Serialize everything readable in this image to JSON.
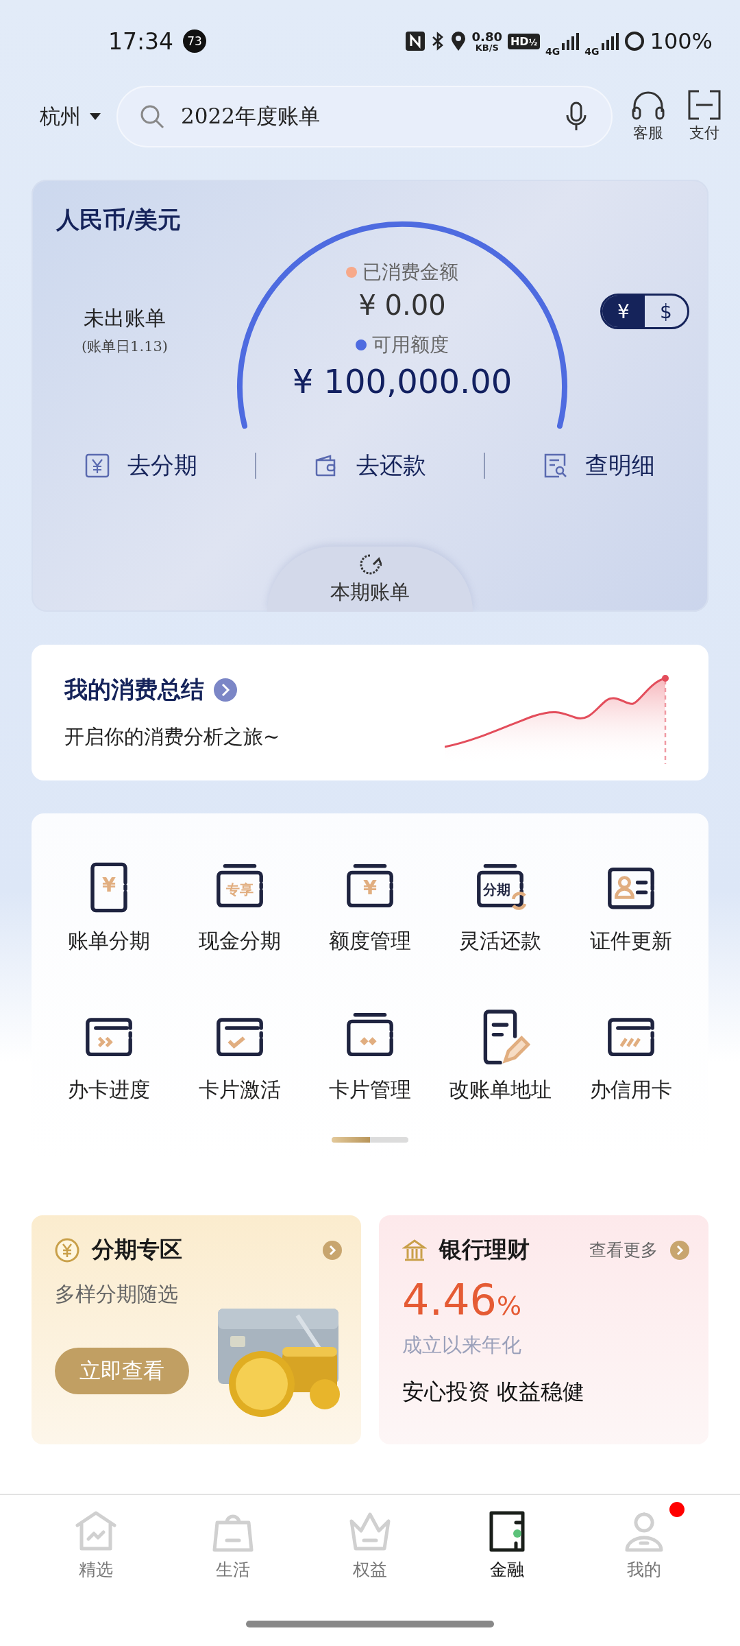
{
  "status_bar": {
    "time": "17:34",
    "notification_count": "73",
    "speed_value": "0.80",
    "speed_unit": "KB/S",
    "hd": "HD",
    "hd_index": "½",
    "networks": [
      "4G",
      "4G"
    ],
    "battery": "100%"
  },
  "header": {
    "city": "杭州",
    "search": {
      "value": "2022年度账单"
    },
    "actions": [
      "客服",
      "支付"
    ]
  },
  "bill_card": {
    "title": "人民币/美元",
    "status": "未出账单",
    "bill_date": "(账单日1.13)",
    "spent_label": "已消费金额",
    "spent_amount": "¥ 0.00",
    "available_label": "可用额度",
    "available_amount": "¥ 100,000.00",
    "currencies": [
      {
        "label": "¥",
        "selected": true
      },
      {
        "label": "$",
        "selected": false
      }
    ],
    "actions": [
      {
        "label": "去分期",
        "kind": "installment"
      },
      {
        "label": "去还款",
        "kind": "repay"
      },
      {
        "label": "查明细",
        "kind": "details"
      }
    ],
    "current_bill": "本期账单"
  },
  "summary_card": {
    "title": "我的消费总结",
    "subtitle": "开启你的消费分析之旅~"
  },
  "services": [
    {
      "label": "账单分期",
      "kind": "page",
      "icon_text": "¥"
    },
    {
      "label": "现金分期",
      "kind": "wallet",
      "icon_text": "专享"
    },
    {
      "label": "额度管理",
      "kind": "wallet",
      "icon_text": "¥"
    },
    {
      "label": "灵活还款",
      "kind": "cycle",
      "icon_text": "分期"
    },
    {
      "label": "证件更新",
      "kind": "id"
    },
    {
      "label": "办卡进度",
      "kind": "progress"
    },
    {
      "label": "卡片激活",
      "kind": "check"
    },
    {
      "label": "卡片管理",
      "kind": "manage"
    },
    {
      "label": "改账单地址",
      "kind": "doc"
    },
    {
      "label": "办信用卡",
      "kind": "card"
    }
  ],
  "promos": [
    {
      "kind": "installment",
      "title": "分期专区",
      "subtitle": "多样分期随选",
      "button": "立即查看"
    },
    {
      "kind": "wealth",
      "title": "银行理财",
      "more": "查看更多",
      "rate": "4.46",
      "rate_unit": "%",
      "rate_label": "成立以来年化",
      "slogan": "安心投资 收益稳健"
    }
  ],
  "bottom_nav": [
    {
      "label": "精选",
      "kind": "home",
      "selected": false,
      "badge": false
    },
    {
      "label": "生活",
      "kind": "bag",
      "selected": false,
      "badge": false
    },
    {
      "label": "权益",
      "kind": "crown",
      "selected": false,
      "badge": false
    },
    {
      "label": "金融",
      "kind": "wallet",
      "selected": true,
      "badge": false
    },
    {
      "label": "我的",
      "kind": "person",
      "selected": false,
      "badge": true
    }
  ]
}
